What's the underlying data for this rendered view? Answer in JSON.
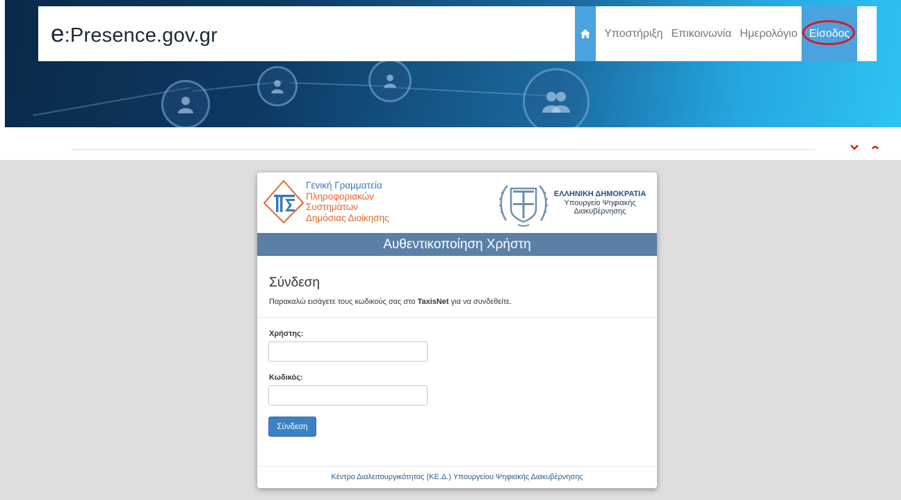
{
  "header": {
    "logo_prefix": "e",
    "logo_rest": ":Presence.gov.gr",
    "nav": {
      "home_icon": "home-icon",
      "items": [
        "Υποστήριξη",
        "Επικοινωνία",
        "Ημερολόγιο"
      ],
      "login_label": "Είσοδος"
    }
  },
  "card": {
    "org_left": {
      "lines": [
        "Γενική Γραμματεία",
        "Πληροφοριακών",
        "Συστημάτων",
        "Δημόσιας Διοίκησης"
      ]
    },
    "org_right": {
      "lines": [
        "ΕΛΛΗΝΙΚΗ ΔΗΜΟΚΡΑΤΙΑ",
        "Υπουργείο Ψηφιακής",
        "Διακυβέρνησης"
      ]
    },
    "title": "Αυθεντικοποίηση Χρήστη",
    "heading": "Σύνδεση",
    "instructions": {
      "before": "Παρακαλώ εισάγετε τους κωδικούς σας στο ",
      "bold": "TaxisNet",
      "after": " για να συνδεθείτε."
    },
    "username_label": "Χρήστης:",
    "username_value": "",
    "password_label": "Κωδικός:",
    "password_value": "",
    "submit_label": "Σύνδεση",
    "footer": "Κέντρο Διαλειτουργικότητας (ΚΕ.Δ.) Υπουργείου Ψηφιακής Διακυβέρνησης"
  },
  "colors": {
    "nav_accent": "#4aa3df",
    "annotation_red": "#e3141c",
    "title_bar": "#5c7fa6",
    "button": "#3a82c4",
    "gsis_blue": "#3a79b7",
    "gsis_orange": "#e2662b"
  }
}
